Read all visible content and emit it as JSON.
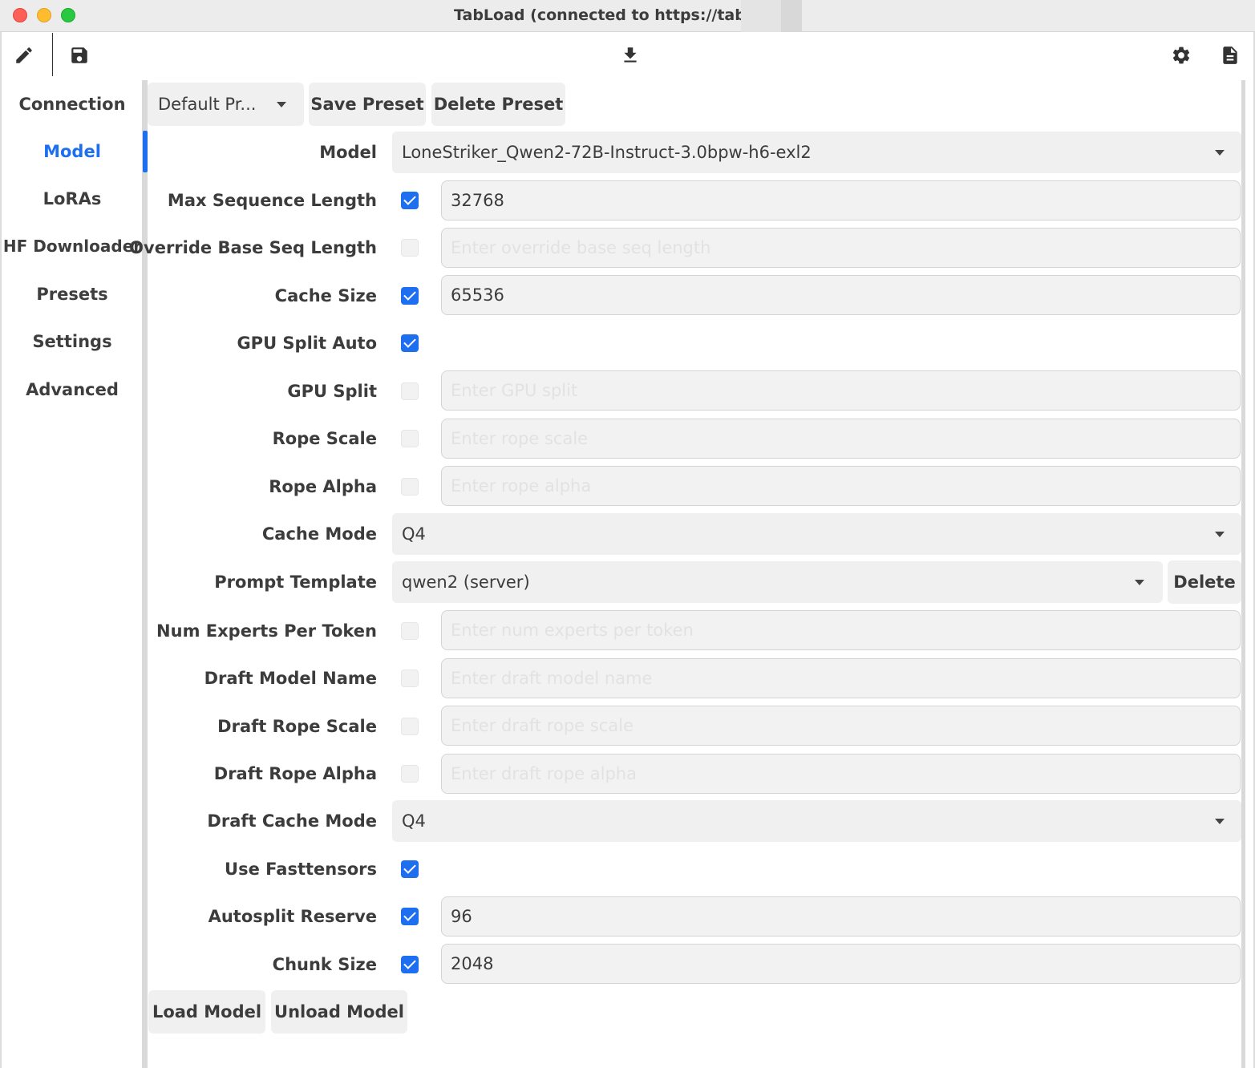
{
  "window": {
    "title": "TabLoad (connected to https://tabby"
  },
  "toolbar": {
    "icons": [
      "edit-icon",
      "save-icon",
      "download-icon",
      "gear-icon",
      "document-icon"
    ]
  },
  "sidebar": {
    "items": [
      {
        "label": "Connection",
        "active": false
      },
      {
        "label": "Model",
        "active": true
      },
      {
        "label": "LoRAs",
        "active": false
      },
      {
        "label": "HF Downloader",
        "active": false
      },
      {
        "label": "Presets",
        "active": false
      },
      {
        "label": "Settings",
        "active": false
      },
      {
        "label": "Advanced",
        "active": false
      }
    ]
  },
  "presets": {
    "selected": "Default Pr...",
    "save_label": "Save Preset",
    "delete_label": "Delete Preset"
  },
  "form": {
    "model": {
      "label": "Model",
      "value": "LoneStriker_Qwen2-72B-Instruct-3.0bpw-h6-exl2"
    },
    "max_seq_len": {
      "label": "Max Sequence Length",
      "checked": true,
      "value": "32768",
      "placeholder": ""
    },
    "override_base_seq_len": {
      "label": "Override Base Seq Length",
      "checked": false,
      "value": "",
      "placeholder": "Enter override base seq length"
    },
    "cache_size": {
      "label": "Cache Size",
      "checked": true,
      "value": "65536",
      "placeholder": ""
    },
    "gpu_split_auto": {
      "label": "GPU Split Auto",
      "checked": true
    },
    "gpu_split": {
      "label": "GPU Split",
      "checked": false,
      "value": "",
      "placeholder": "Enter GPU split"
    },
    "rope_scale": {
      "label": "Rope Scale",
      "checked": false,
      "value": "",
      "placeholder": "Enter rope scale"
    },
    "rope_alpha": {
      "label": "Rope Alpha",
      "checked": false,
      "value": "",
      "placeholder": "Enter rope alpha"
    },
    "cache_mode": {
      "label": "Cache Mode",
      "value": "Q4"
    },
    "prompt_template": {
      "label": "Prompt Template",
      "value": "qwen2 (server)",
      "delete_label": "Delete"
    },
    "num_experts": {
      "label": "Num Experts Per Token",
      "checked": false,
      "value": "",
      "placeholder": "Enter num experts per token"
    },
    "draft_model_name": {
      "label": "Draft Model Name",
      "checked": false,
      "value": "",
      "placeholder": "Enter draft model name"
    },
    "draft_rope_scale": {
      "label": "Draft Rope Scale",
      "checked": false,
      "value": "",
      "placeholder": "Enter draft rope scale"
    },
    "draft_rope_alpha": {
      "label": "Draft Rope Alpha",
      "checked": false,
      "value": "",
      "placeholder": "Enter draft rope alpha"
    },
    "draft_cache_mode": {
      "label": "Draft Cache Mode",
      "value": "Q4"
    },
    "use_fasttensors": {
      "label": "Use Fasttensors",
      "checked": true
    },
    "autosplit_reserve": {
      "label": "Autosplit Reserve",
      "checked": true,
      "value": "96",
      "placeholder": ""
    },
    "chunk_size": {
      "label": "Chunk Size",
      "checked": true,
      "value": "2048",
      "placeholder": ""
    }
  },
  "actions": {
    "load_label": "Load Model",
    "unload_label": "Unload Model"
  },
  "colors": {
    "accent": "#1e6ff0",
    "control_bg": "#f0f0f0",
    "field_border": "#d4d4d4"
  }
}
